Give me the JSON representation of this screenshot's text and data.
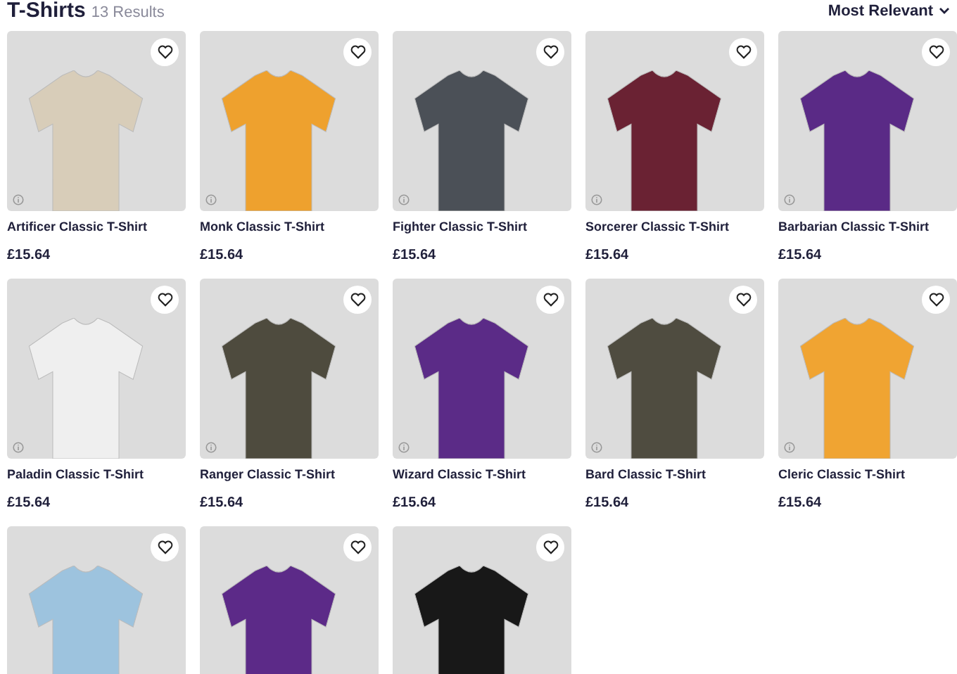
{
  "header": {
    "title": "T-Shirts",
    "count": "13 Results",
    "sort": "Most Relevant"
  },
  "products": [
    {
      "name": "Artificer Classic T-Shirt",
      "price": "£15.64",
      "color": "#d8cdb9"
    },
    {
      "name": "Monk Classic T-Shirt",
      "price": "£15.64",
      "color": "#eea12e"
    },
    {
      "name": "Fighter Classic T-Shirt",
      "price": "£15.64",
      "color": "#4b5057"
    },
    {
      "name": "Sorcerer Classic T-Shirt",
      "price": "£15.64",
      "color": "#6a2233"
    },
    {
      "name": "Barbarian Classic T-Shirt",
      "price": "£15.64",
      "color": "#5a2a86"
    },
    {
      "name": "Paladin Classic T-Shirt",
      "price": "£15.64",
      "color": "#efefef"
    },
    {
      "name": "Ranger Classic T-Shirt",
      "price": "£15.64",
      "color": "#4e4b3e"
    },
    {
      "name": "Wizard Classic T-Shirt",
      "price": "£15.64",
      "color": "#5b2b87"
    },
    {
      "name": "Bard Classic T-Shirt",
      "price": "£15.64",
      "color": "#4f4c40"
    },
    {
      "name": "Cleric Classic T-Shirt",
      "price": "£15.64",
      "color": "#f0a432"
    },
    {
      "color": "#9dc3de"
    },
    {
      "color": "#5c2a88"
    },
    {
      "color": "#181818"
    }
  ]
}
